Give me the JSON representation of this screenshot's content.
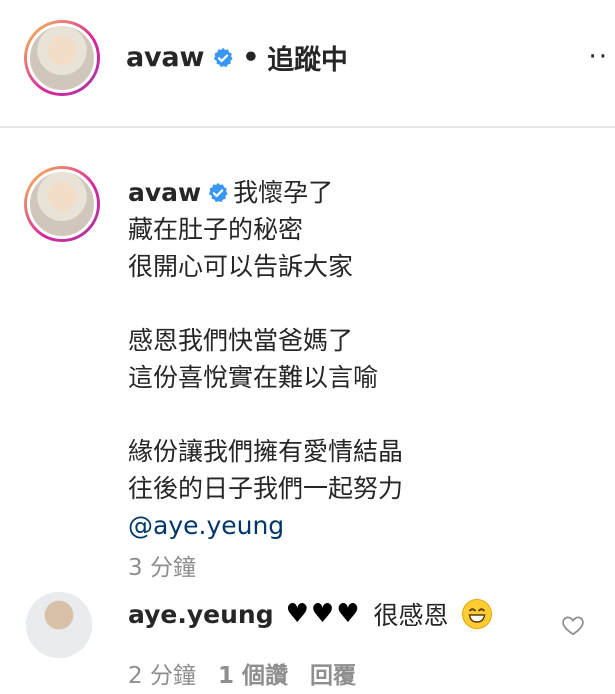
{
  "header": {
    "username": "avaw",
    "separator": "•",
    "follow_status": "追蹤中",
    "more_label": "··"
  },
  "caption": {
    "username": "avaw",
    "lines": [
      "我懷孕了",
      "藏在肚子的秘密",
      "很開心可以告訴大家",
      "",
      "感恩我們快當爸媽了",
      "這份喜悅實在難以言喻",
      "",
      "緣份讓我們擁有愛情結晶",
      "往後的日子我們一起努力"
    ],
    "mention": "@aye.yeung",
    "time": "3 分鐘"
  },
  "reply": {
    "username": "aye.yeung",
    "hearts": "♥♥♥",
    "text": "很感恩",
    "emoji": "grinning-face-icon",
    "time": "2 分鐘",
    "likes": "1 個讚",
    "reply_label": "回覆"
  },
  "colors": {
    "verified": "#3897f0",
    "mention": "#00376b",
    "muted": "#8e8e8e"
  }
}
